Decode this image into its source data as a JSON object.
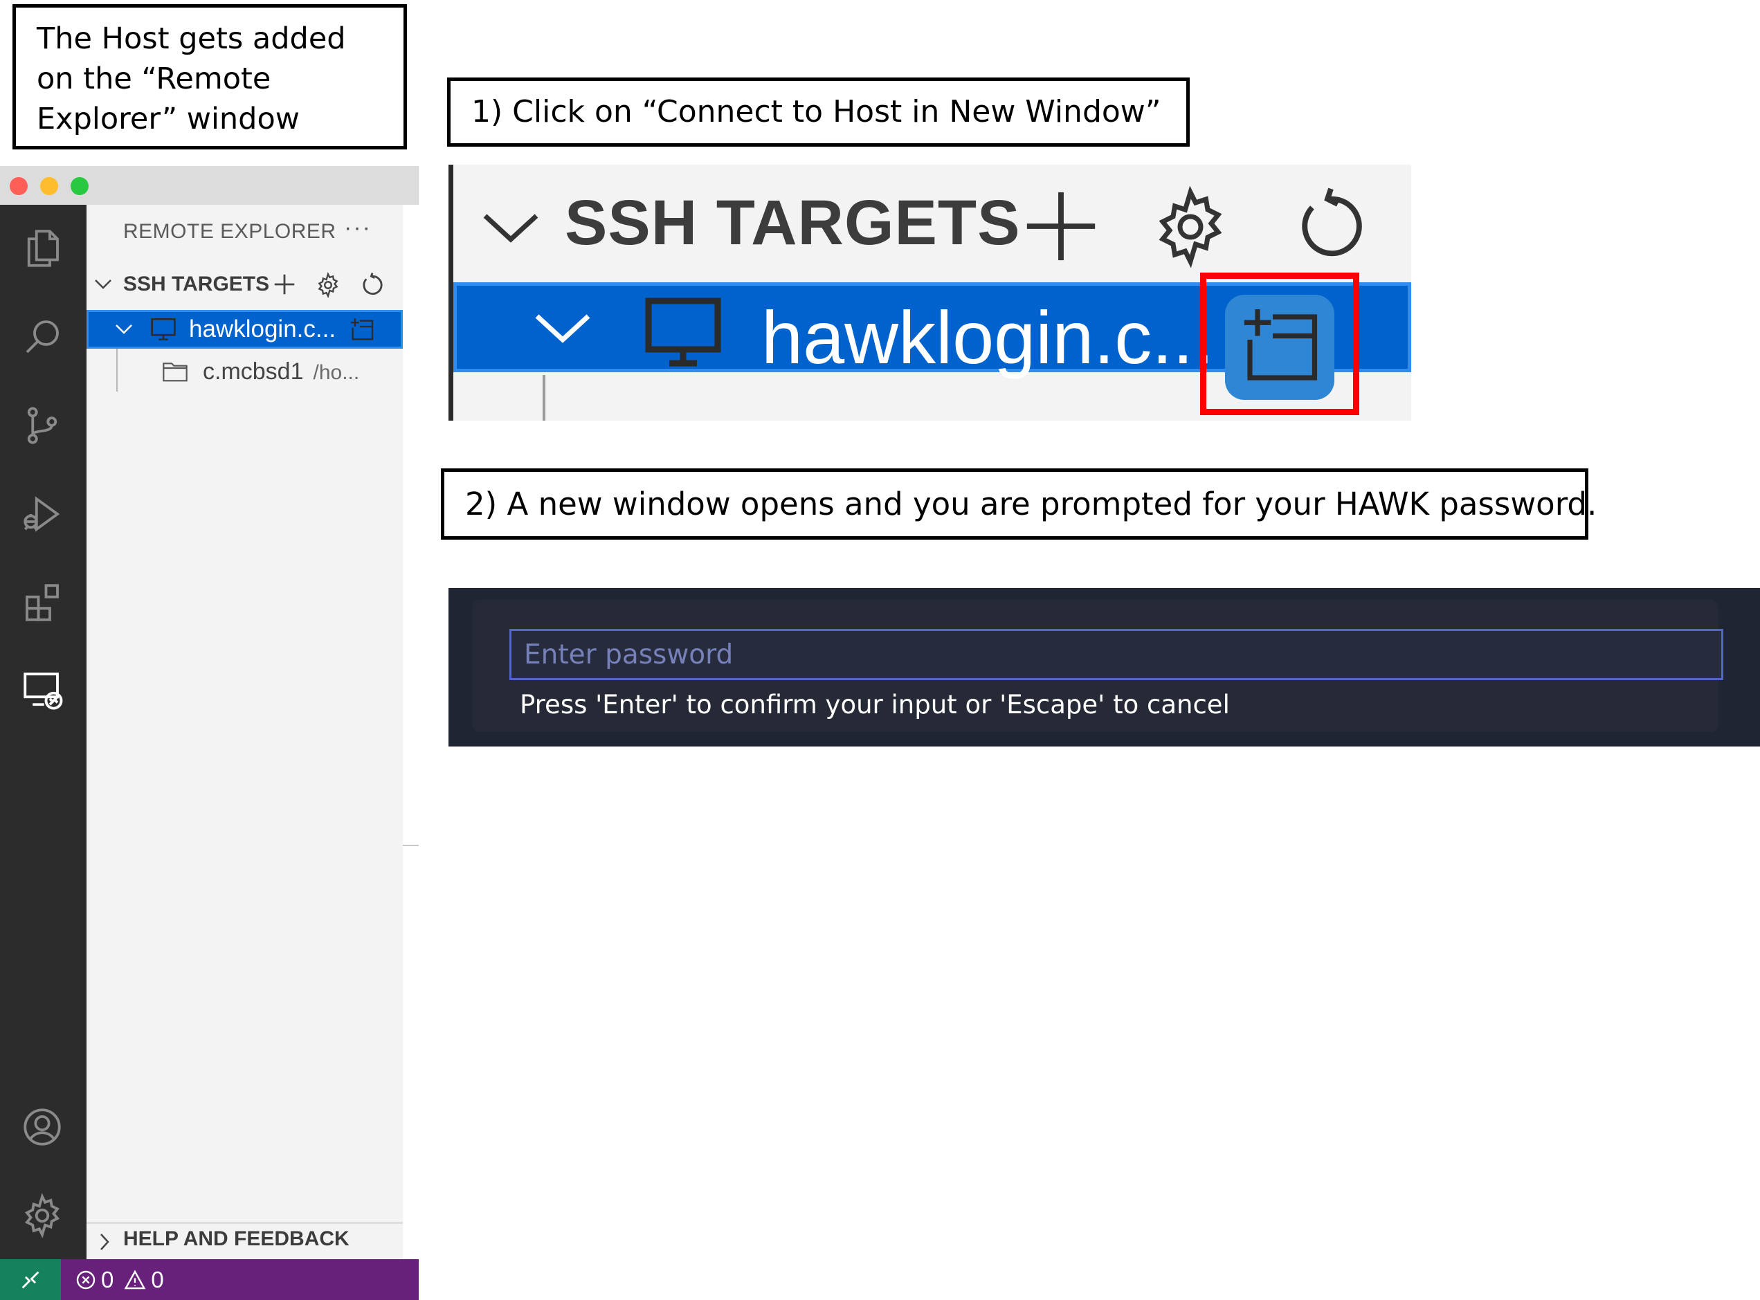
{
  "callouts": {
    "host_added": "The Host gets added on the “Remote Explorer” window",
    "step1": "1) Click on “Connect to Host in New Window”",
    "step2": "2) A new window opens and you are prompted for your HAWK password."
  },
  "vscode": {
    "traffic_lights": [
      "#ff5f57",
      "#febc2e",
      "#28c840"
    ],
    "activity_bar": [
      {
        "name": "explorer",
        "icon": "files-icon"
      },
      {
        "name": "search",
        "icon": "search-icon"
      },
      {
        "name": "source-control",
        "icon": "source-control-icon"
      },
      {
        "name": "run-debug",
        "icon": "run-debug-icon"
      },
      {
        "name": "extensions",
        "icon": "extensions-icon"
      },
      {
        "name": "remote-explorer",
        "icon": "remote-explorer-icon",
        "active": true
      },
      {
        "name": "accounts",
        "icon": "account-icon"
      },
      {
        "name": "manage",
        "icon": "gear-icon"
      }
    ],
    "sidebar": {
      "title": "REMOTE EXPLORER",
      "more": "···",
      "section": "SSH TARGETS",
      "host": "hawklogin.c...",
      "folder": "c.mcbsd1",
      "folder_path": "/ho...",
      "footer_section": "HELP AND FEEDBACK"
    },
    "status_bar": {
      "errors": "0",
      "warnings": "0"
    },
    "colors": {
      "activity_bar": "#2c2c2c",
      "selection": "#0062cc",
      "status_bar": "#68217a",
      "remote_indicator": "#16825d"
    }
  },
  "zoom": {
    "section": "SSH TARGETS",
    "host": "hawklogin.c...",
    "highlight_color": "#ff0000"
  },
  "prompt": {
    "placeholder": "Enter password",
    "hint": "Press 'Enter' to confirm your input or 'Escape' to cancel"
  }
}
